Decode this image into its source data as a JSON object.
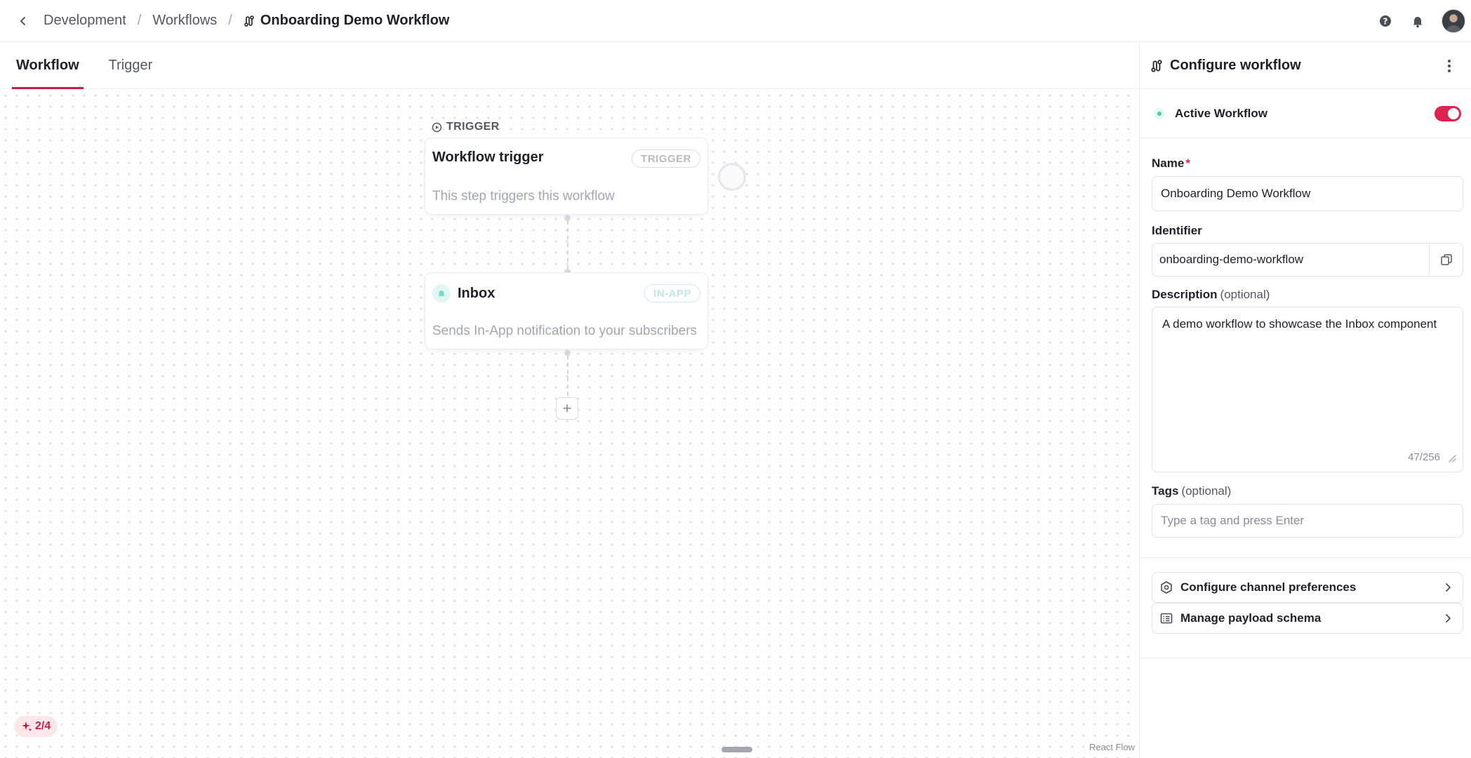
{
  "breadcrumb": {
    "items": [
      "Development",
      "Workflows"
    ],
    "separator": "/",
    "current": "Onboarding Demo Workflow"
  },
  "header_icons": [
    "help-icon",
    "bell-icon",
    "avatar"
  ],
  "tabs": [
    {
      "label": "Workflow",
      "active": true
    },
    {
      "label": "Trigger",
      "active": false
    }
  ],
  "canvas": {
    "trigger_section_label": "TRIGGER",
    "nodes": [
      {
        "title": "Workflow trigger",
        "badge": "TRIGGER",
        "description": "This step triggers this workflow"
      },
      {
        "title": "Inbox",
        "badge": "IN-APP",
        "description": "Sends In-App notification to your subscribers",
        "icon": "bell-icon"
      }
    ],
    "add_step_symbol": "+",
    "step_counter": "2/4",
    "attribution": "React Flow"
  },
  "panel": {
    "title": "Configure workflow",
    "active_label": "Active Workflow",
    "active_on": true,
    "name": {
      "label": "Name",
      "required_mark": "*",
      "value": "Onboarding Demo Workflow"
    },
    "identifier": {
      "label": "Identifier",
      "value": "onboarding-demo-workflow"
    },
    "description": {
      "label": "Description",
      "optional": "(optional)",
      "value": "A demo workflow to showcase the Inbox component",
      "counter": "47/256"
    },
    "tags": {
      "label": "Tags",
      "optional": "(optional)",
      "placeholder": "Type a tag and press Enter"
    },
    "links": [
      {
        "label": "Configure channel preferences",
        "icon": "hexagon-settings-icon"
      },
      {
        "label": "Manage payload schema",
        "icon": "schema-list-icon"
      }
    ]
  },
  "colors": {
    "accent": "#c41e45",
    "toggle_on": "#dd2450",
    "status_green": "#4cc9a8"
  }
}
